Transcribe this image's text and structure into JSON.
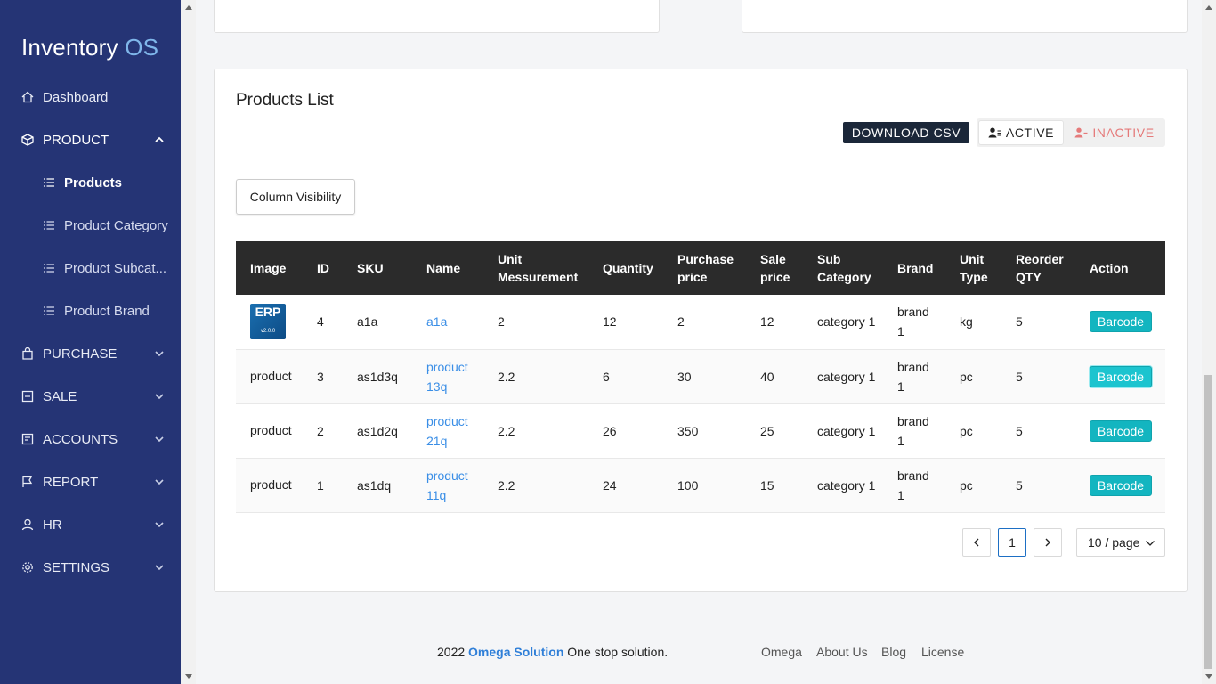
{
  "app": {
    "title_main": "Inventory",
    "title_accent": "OS"
  },
  "sidebar": {
    "dashboard": "Dashboard",
    "product": "PRODUCT",
    "products": "Products",
    "product_category": "Product Category",
    "product_subcategory": "Product Subcat...",
    "product_brand": "Product Brand",
    "purchase": "PURCHASE",
    "sale": "SALE",
    "accounts": "ACCOUNTS",
    "report": "REPORT",
    "hr": "HR",
    "settings": "SETTINGS"
  },
  "products_card": {
    "title": "Products List",
    "download_csv": "DOWNLOAD CSV",
    "active": "ACTIVE",
    "inactive": "INACTIVE",
    "column_visibility": "Column Visibility"
  },
  "table": {
    "headers": {
      "image": "Image",
      "id": "ID",
      "sku": "SKU",
      "name": "Name",
      "unit_measurement": "Unit Messurement",
      "quantity": "Quantity",
      "purchase_price": "Purchase price",
      "sale_price": "Sale price",
      "sub_category": "Sub Category",
      "brand": "Brand",
      "unit_type": "Unit Type",
      "reorder_qty": "Reorder QTY",
      "action": "Action"
    },
    "rows": [
      {
        "image_text": "ERP",
        "image_version": "v2.0.0",
        "id": "4",
        "sku": "a1a",
        "name": "a1a",
        "unit": "2",
        "quantity": "12",
        "purchase": "2",
        "sale": "12",
        "subcategory": "category 1",
        "brand": "brand 1",
        "unit_type": "kg",
        "reorder": "5",
        "action": "Barcode"
      },
      {
        "image_alt": "product",
        "id": "3",
        "sku": "as1d3q",
        "name": "product 13q",
        "unit": "2.2",
        "quantity": "6",
        "purchase": "30",
        "sale": "40",
        "subcategory": "category 1",
        "brand": "brand 1",
        "unit_type": "pc",
        "reorder": "5",
        "action": "Barcode"
      },
      {
        "image_alt": "product",
        "id": "2",
        "sku": "as1d2q",
        "name": "product 21q",
        "unit": "2.2",
        "quantity": "26",
        "purchase": "350",
        "sale": "25",
        "subcategory": "category 1",
        "brand": "brand 1",
        "unit_type": "pc",
        "reorder": "5",
        "action": "Barcode"
      },
      {
        "image_alt": "product",
        "id": "1",
        "sku": "as1dq",
        "name": "product 11q",
        "unit": "2.2",
        "quantity": "24",
        "purchase": "100",
        "sale": "15",
        "subcategory": "category 1",
        "brand": "brand 1",
        "unit_type": "pc",
        "reorder": "5",
        "action": "Barcode"
      }
    ]
  },
  "pagination": {
    "current_page": "1",
    "per_page": "10 / page"
  },
  "footer": {
    "year": "2022",
    "company": "Omega Solution",
    "tagline": "One stop solution.",
    "links": [
      "Omega",
      "About Us",
      "Blog",
      "License"
    ]
  },
  "colors": {
    "sidebar_bg": "#253475",
    "accent": "#7fb6ea",
    "barcode": "#13b5c0",
    "inactive": "#e57a7a"
  }
}
